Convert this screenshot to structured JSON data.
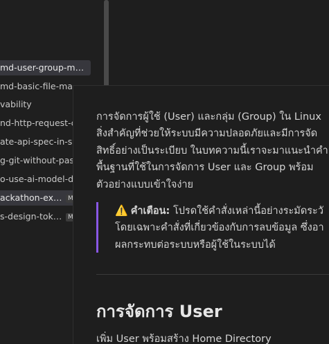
{
  "sidebar": {
    "items": [
      {
        "label": "md-user-group-m…",
        "badge": ""
      },
      {
        "label": "md-basic-file-ma",
        "badge": ""
      },
      {
        "label": "vability",
        "badge": ""
      },
      {
        "label": "nd-http-request-c",
        "badge": ""
      },
      {
        "label": "ate-api-spec-in-s",
        "badge": ""
      },
      {
        "label": "g-git-without-pass",
        "badge": ""
      },
      {
        "label": "o-use-ai-model-d",
        "badge": ""
      },
      {
        "label": "ackathon-ex…",
        "badge": "M"
      },
      {
        "label": "s-design-tok…",
        "badge": "M"
      }
    ]
  },
  "editor": {
    "intro_lines": [
      "การจัดการผู้ใช้ (User) และกลุ่ม (Group) ใน Linux",
      "สิ่งสำคัญที่ช่วยให้ระบบมีความปลอดภัยและมีการจัด",
      "สิทธิ์อย่างเป็นระเบียบ ในบทความนี้เราจะมาแนะนำคำ",
      "พื้นฐานที่ใช้ในการจัดการ User และ Group พร้อม",
      "ตัวอย่างแบบเข้าใจง่าย"
    ],
    "callout": {
      "icon": "warning-icon",
      "label": "คำเตือน:",
      "line1": "โปรดใช้คำสั่งเหล่านี้อย่างระมัดระวั",
      "line2": "โดยเฉพาะคำสั่งที่เกี่ยวข้องกับการลบข้อมูล ซึ่งอา",
      "line3": "ผลกระทบต่อระบบหรือผู้ใช้ในระบบได้"
    },
    "heading": "การจัดการ User",
    "subline": "เพิ่ม User พร้อมสร้าง Home Directory"
  },
  "colors": {
    "background": "#1e1e1e",
    "callout_border": "#8957e5",
    "warning_icon": "#f2c744"
  }
}
